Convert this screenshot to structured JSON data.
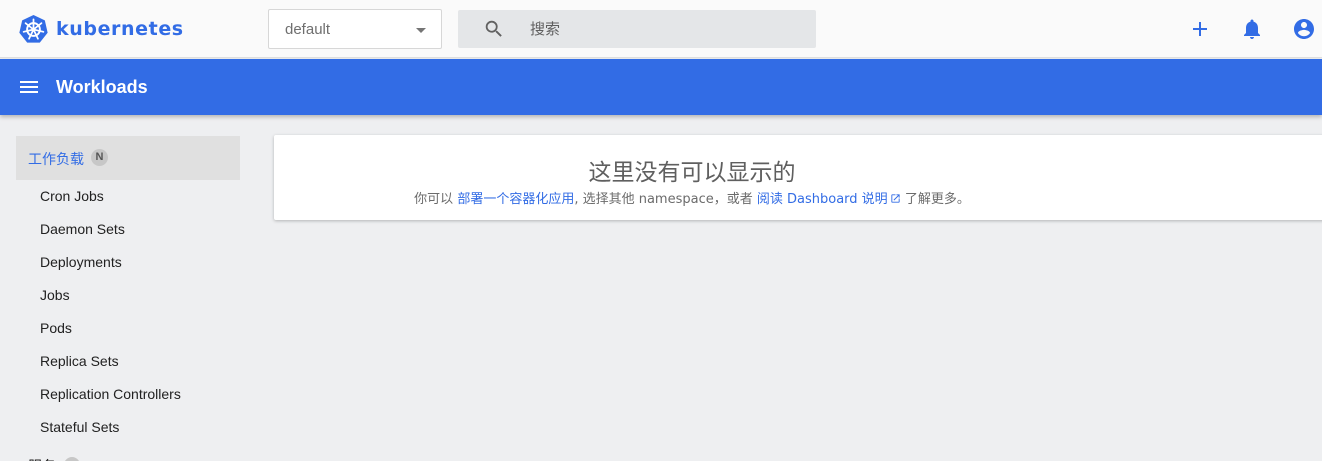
{
  "header": {
    "brand": "kubernetes",
    "namespace": {
      "selected": "default"
    },
    "search": {
      "placeholder": "搜索"
    },
    "actions": [
      "add-icon",
      "bell-icon",
      "account-icon"
    ]
  },
  "toolbar": {
    "title": "Workloads"
  },
  "sidebar": {
    "section": {
      "label": "工作负载",
      "badge": "N"
    },
    "items": [
      {
        "label": "Cron Jobs"
      },
      {
        "label": "Daemon Sets"
      },
      {
        "label": "Deployments"
      },
      {
        "label": "Jobs"
      },
      {
        "label": "Pods"
      },
      {
        "label": "Replica Sets"
      },
      {
        "label": "Replication Controllers"
      },
      {
        "label": "Stateful Sets"
      }
    ],
    "next_section": {
      "label": "服务"
    }
  },
  "empty_state": {
    "title": "这里没有可以显示的",
    "prefix": "你可以",
    "deploy_link": "部署一个容器化应用",
    "middle": ", 选择其他 namespace，或者",
    "docs_link": "阅读 Dashboard 说明",
    "suffix": "了解更多。"
  },
  "colors": {
    "brand": "#326ce5",
    "background": "#eeeff1",
    "header": "#fafafa",
    "toolbar": "#326ce5",
    "selected_nav": "#e0e0e0"
  }
}
